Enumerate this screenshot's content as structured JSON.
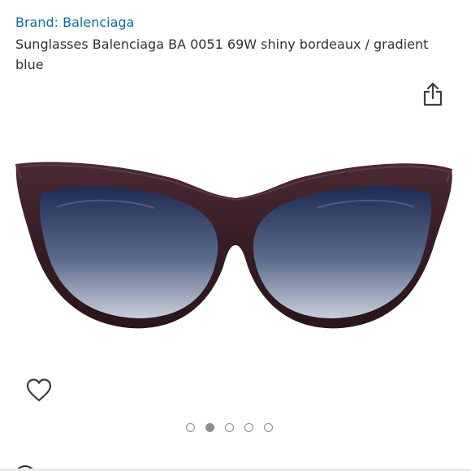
{
  "product": {
    "brand_link": "Brand: Balenciaga",
    "title": "Sunglasses Balenciaga BA 0051 69W shiny bordeaux / gradient blue"
  },
  "icons": {
    "share": "share-icon",
    "wishlist": "heart-icon"
  },
  "image": {
    "alt": "Balenciaga cat-eye sunglasses, shiny bordeaux frame with gradient blue lenses"
  },
  "carousel": {
    "total_images": 5,
    "active_index": 1
  },
  "colors": {
    "link": "#0a6e9c",
    "text": "#2e3134",
    "frame": "#3a2027",
    "dot_active": "#8d8f92"
  }
}
